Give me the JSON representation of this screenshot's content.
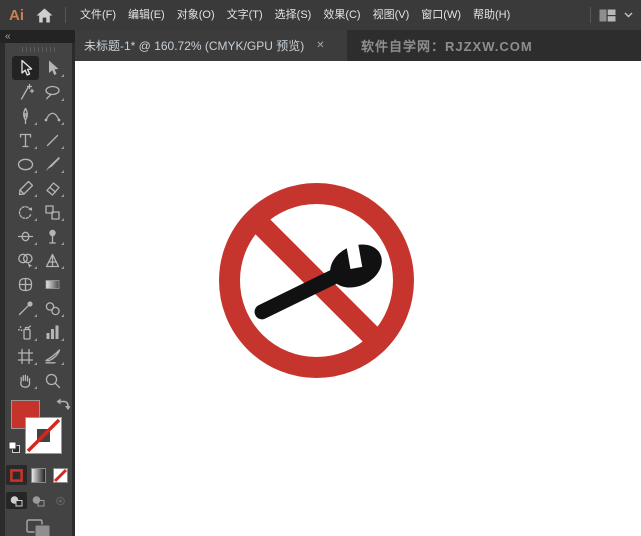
{
  "menubar": {
    "logo": "Ai",
    "items": [
      "文件(F)",
      "编辑(E)",
      "对象(O)",
      "文字(T)",
      "选择(S)",
      "效果(C)",
      "视图(V)",
      "窗口(W)",
      "帮助(H)"
    ]
  },
  "tabbar": {
    "tab_title": "未标题-1* @ 160.72% (CMYK/GPU 预览)",
    "close_label": "✕",
    "watermark": "软件自学网：RJZXW.COM"
  },
  "toolbar": {
    "collapse_label": "«",
    "selected_tool": "selection",
    "tools": [
      "selection",
      "direct-selection",
      "magic-wand",
      "lasso",
      "pen",
      "curvature",
      "type",
      "line-segment",
      "ellipse",
      "paintbrush",
      "pencil",
      "eraser",
      "rotate",
      "scale",
      "width",
      "puppet-warp",
      "shape-builder",
      "perspective-grid",
      "mesh",
      "gradient",
      "eyedropper",
      "blend",
      "symbol-sprayer",
      "column-graph",
      "artboard",
      "slice",
      "hand",
      "zoom"
    ],
    "fill_color": "#c5332b",
    "stroke_style": "none",
    "active_color_mode": "color",
    "active_draw_mode": "draw-normal"
  },
  "canvas": {
    "sign": {
      "description": "no-wrench prohibition sign",
      "ring_color": "#c6352d",
      "slash_color": "#c6352d",
      "wrench_color": "#111111"
    }
  }
}
